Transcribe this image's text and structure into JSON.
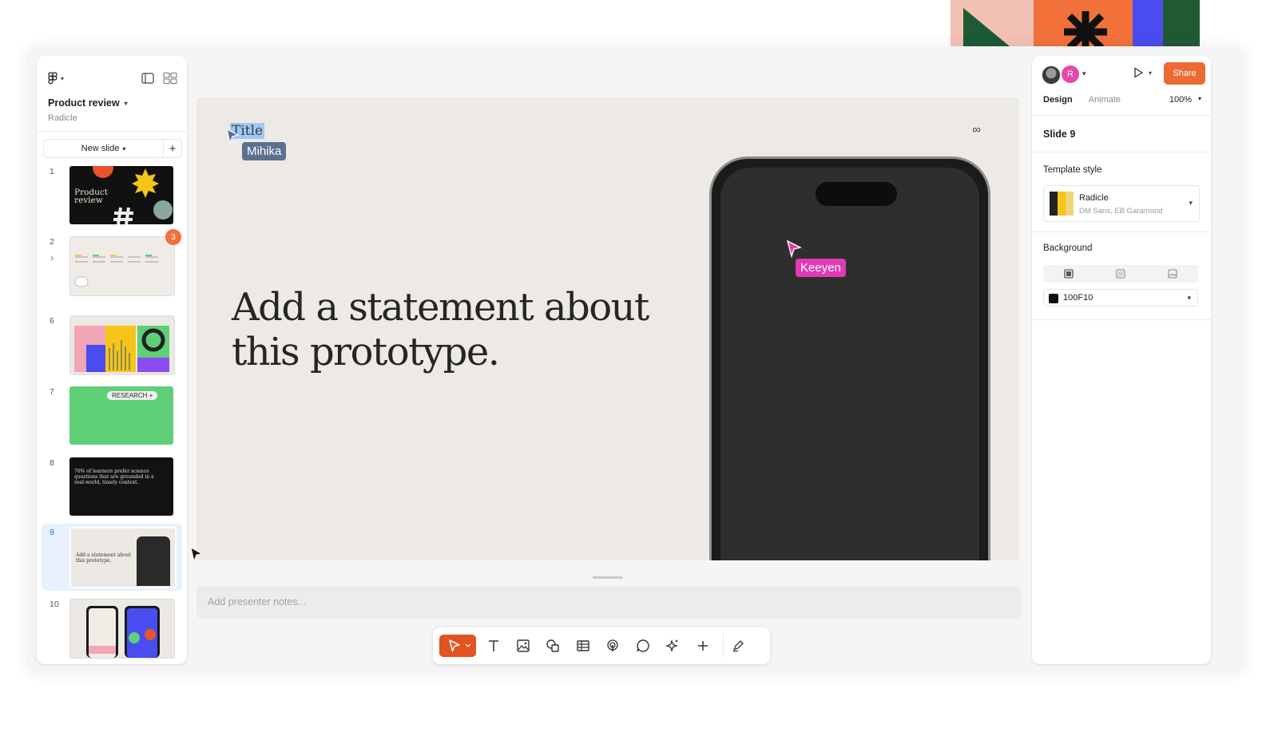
{
  "app": {
    "file_title": "Product review",
    "team": "Radicle"
  },
  "sidebar": {
    "new_slide_label": "New slide",
    "slides": [
      {
        "number": "1",
        "thumb_text": "Product review"
      },
      {
        "number": "2",
        "comment_count": "3"
      },
      {
        "number": "6"
      },
      {
        "number": "7",
        "thumb_tag": "RESEARCH +"
      },
      {
        "number": "8",
        "thumb_text": "76% of learners prefer science questions that are grounded in a real-world, timely context."
      },
      {
        "number": "9",
        "thumb_text": "Add a statement about this prototype.",
        "selected": true
      },
      {
        "number": "10"
      }
    ]
  },
  "canvas": {
    "title_placeholder": "Title",
    "statement": "Add a statement about this prototype.",
    "collaborators": [
      {
        "name": "Mihika",
        "color": "#5c6f8f"
      },
      {
        "name": "Keeyen",
        "color": "#e03bb3"
      }
    ],
    "notes_placeholder": "Add presenter notes..."
  },
  "toolbar": {
    "tools": [
      "move-tool",
      "text-tool",
      "image-tool",
      "shape-tool",
      "table-tool",
      "interaction-tool",
      "comment-tool",
      "ai-tool",
      "add-tool",
      "annotate-tool"
    ]
  },
  "right_panel": {
    "avatar_initial": "R",
    "share_label": "Share",
    "tabs": [
      "Design",
      "Animate"
    ],
    "active_tab": "Design",
    "zoom": "100%",
    "slide_label": "Slide 9",
    "template_style_heading": "Template style",
    "template_name": "Radicle",
    "template_fonts": "DM Sans,  EB Garamond",
    "background_heading": "Background",
    "background_color": "100F10"
  },
  "colors": {
    "accent": "#ee6a35",
    "selection": "#9ec8f6",
    "slide_bg": "#ede9e4"
  }
}
